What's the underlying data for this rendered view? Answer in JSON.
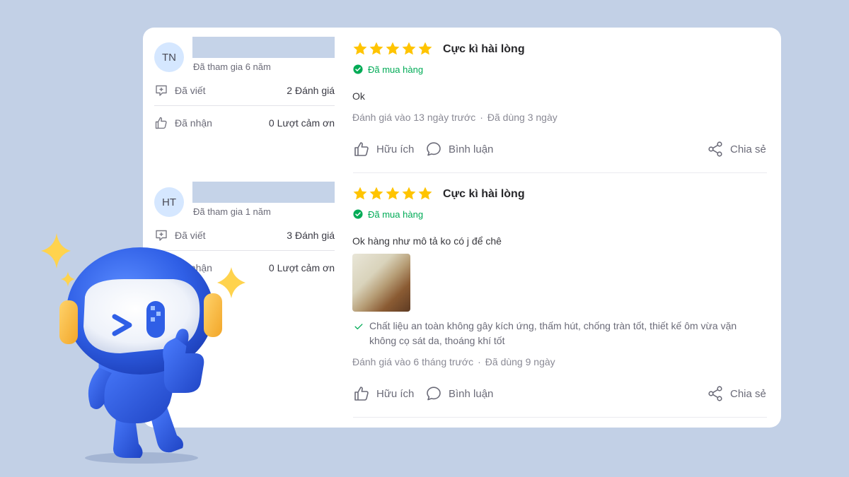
{
  "reviews": [
    {
      "avatar_initials": "TN",
      "joined": "Đã tham gia 6 năm",
      "written_label": "Đã viết",
      "written_value": "2 Đánh giá",
      "received_label": "Đã nhận",
      "received_value": "0 Lượt cảm ơn",
      "rating": 5,
      "title": "Cực kì hài lòng",
      "bought_label": "Đã mua hàng",
      "content": "Ok",
      "meta_time": "Đánh giá vào 13 ngày trước",
      "meta_used": "Đã dùng 3 ngày",
      "helpful_label": "Hữu ích",
      "comment_label": "Bình luận",
      "share_label": "Chia sẻ"
    },
    {
      "avatar_initials": "HT",
      "joined": "Đã tham gia 1 năm",
      "written_label": "Đã viết",
      "written_value": "3 Đánh giá",
      "received_label": "Đã nhận",
      "received_value": "0 Lượt cảm ơn",
      "rating": 5,
      "title": "Cực kì hài lòng",
      "bought_label": "Đã mua hàng",
      "content": "Ok hàng như mô tả ko có j để chê",
      "attribute_text": "Chất liệu an toàn không gây kích ứng, thấm hút, chống tràn tốt, thiết kế ôm vừa vặn không cọ sát da, thoáng khí tốt",
      "meta_time": "Đánh giá vào 6 tháng trước",
      "meta_used": "Đã dùng 9 ngày",
      "helpful_label": "Hữu ích",
      "comment_label": "Bình luận",
      "share_label": "Chia sẻ"
    }
  ],
  "meta_separator": "·",
  "colors": {
    "background": "#c2d0e6",
    "star": "#ffc400",
    "bought_green": "#00ab56",
    "avatar_bg": "#d5e7ff"
  },
  "icons": {
    "written": "comment-write-icon",
    "received": "thumbs-up-icon",
    "helpful": "thumbs-up-icon",
    "comment": "speech-bubble-icon",
    "share": "share-icon",
    "bought": "check-circle-icon",
    "attribute": "check-icon"
  }
}
